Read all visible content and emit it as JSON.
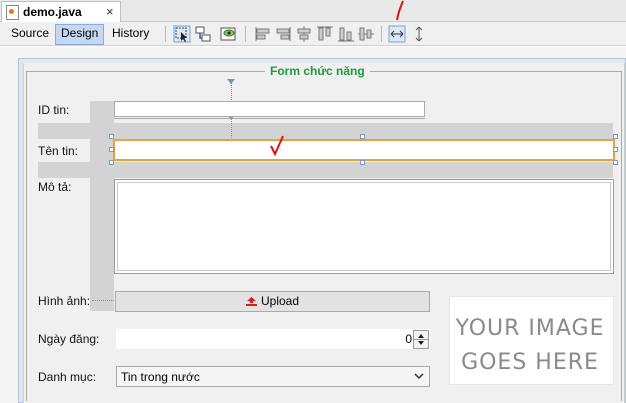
{
  "editor_tab": {
    "title": "demo.java",
    "close": "×"
  },
  "view_tabs": {
    "source": "Source",
    "design": "Design",
    "history": "History"
  },
  "toolbar_icons": [
    "selection-mode-icon",
    "connection-mode-icon",
    "preview-design-icon",
    "align-left-icon",
    "align-right-icon",
    "center-horizontally-icon",
    "align-top-icon",
    "align-bottom-icon",
    "center-vertically-icon",
    "change-horizontal-resizability-icon",
    "change-vertical-resizability-icon"
  ],
  "form": {
    "legend": "Form chức năng",
    "labels": {
      "id": "ID tin:",
      "title": "Tên tin:",
      "description": "Mô tả:",
      "image": "Hình ảnh:",
      "date": "Ngày đăng:",
      "category": "Danh mục:"
    },
    "upload_label": "Upload",
    "date_value": "0",
    "category_value": "Tin trong nước",
    "image_placeholder": [
      "YOUR IMAGE",
      "GOES HERE"
    ]
  },
  "annotation_color": "#e01010",
  "selection_color": "#e8a040",
  "legend_color": "#1e9a3c"
}
